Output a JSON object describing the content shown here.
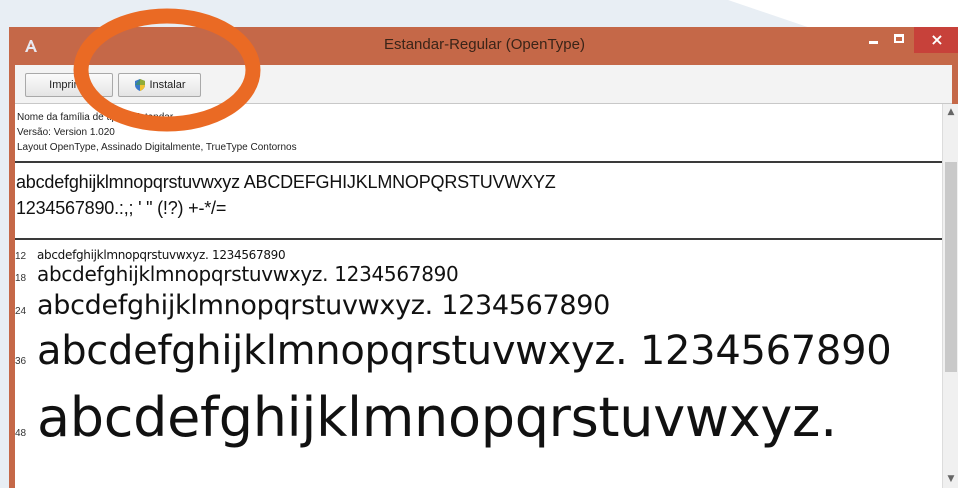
{
  "window": {
    "title": "Estandar-Regular (OpenType)",
    "close_symbol": "×"
  },
  "toolbar": {
    "print_label": "Imprimir",
    "install_label": "Instalar"
  },
  "font_info": {
    "lines": [
      "Nome da família de tipos: Estandar",
      "Versão: Version 1.020",
      "Layout OpenType, Assinado Digitalmente, TrueType Contornos"
    ]
  },
  "charset": {
    "line1": "abcdefghijklmnopqrstuvwxyz ABCDEFGHIJKLMNOPQRSTUVWXYZ",
    "line2": "1234567890.:,; ' \" (!?) +-*/="
  },
  "samples": [
    {
      "size": "12",
      "text": "abcdefghijklmnopqrstuvwxyz. 1234567890"
    },
    {
      "size": "18",
      "text": "abcdefghijklmnopqrstuvwxyz. 1234567890"
    },
    {
      "size": "24",
      "text": "abcdefghijklmnopqrstuvwxyz. 1234567890"
    },
    {
      "size": "36",
      "text": "abcdefghijklmnopqrstuvwxyz. 1234567890"
    },
    {
      "size": "48",
      "text": "abcdefghijklmnopqrstuvwxyz."
    }
  ],
  "scrollbar": {
    "up_glyph": "▲",
    "down_glyph": "▼"
  },
  "colors": {
    "titlebar": "#c56848",
    "close_button": "#c7413a",
    "annotation": "#ea6a24"
  }
}
